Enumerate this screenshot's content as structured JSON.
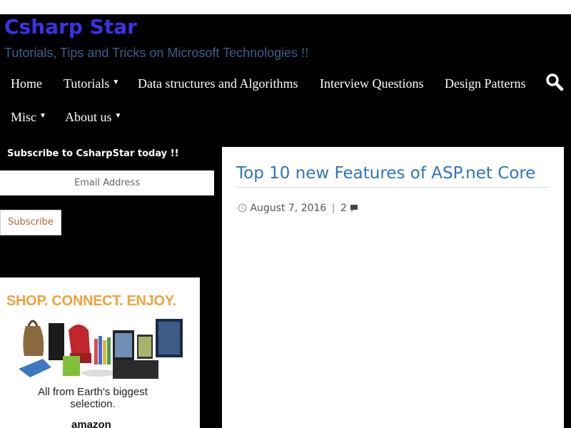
{
  "site": {
    "title": "Csharp Star",
    "tagline": "Tutorials, Tips and Tricks on Microsoft Technologies !!"
  },
  "nav": {
    "items": [
      {
        "label": "Home"
      },
      {
        "label": "Tutorials"
      },
      {
        "label": "Data structures and Algorithms"
      },
      {
        "label": "Interview Questions"
      },
      {
        "label": "Design Patterns"
      },
      {
        "label": "Misc"
      },
      {
        "label": "About us"
      }
    ],
    "search_icon": "search-icon"
  },
  "sidebar": {
    "subscribe_heading": "Subscribe to CsharpStar today !!",
    "email_placeholder": "Email Address",
    "subscribe_label": "Subscribe",
    "ad": {
      "headline": "SHOP. CONNECT. ENJOY.",
      "caption": "All from Earth's biggest selection.",
      "logo": "amazon"
    }
  },
  "post": {
    "title": "Top 10 new Features of ASP.net Core",
    "date": "August 7, 2016",
    "separator": "|",
    "comment_count": "2"
  },
  "colors": {
    "background": "#000000",
    "site_title": "#3a33e6",
    "tagline": "#3d5f8a",
    "post_title": "#2f74b7",
    "subscribe_text": "#b8632c",
    "ad_headline": "#f0a23c"
  }
}
